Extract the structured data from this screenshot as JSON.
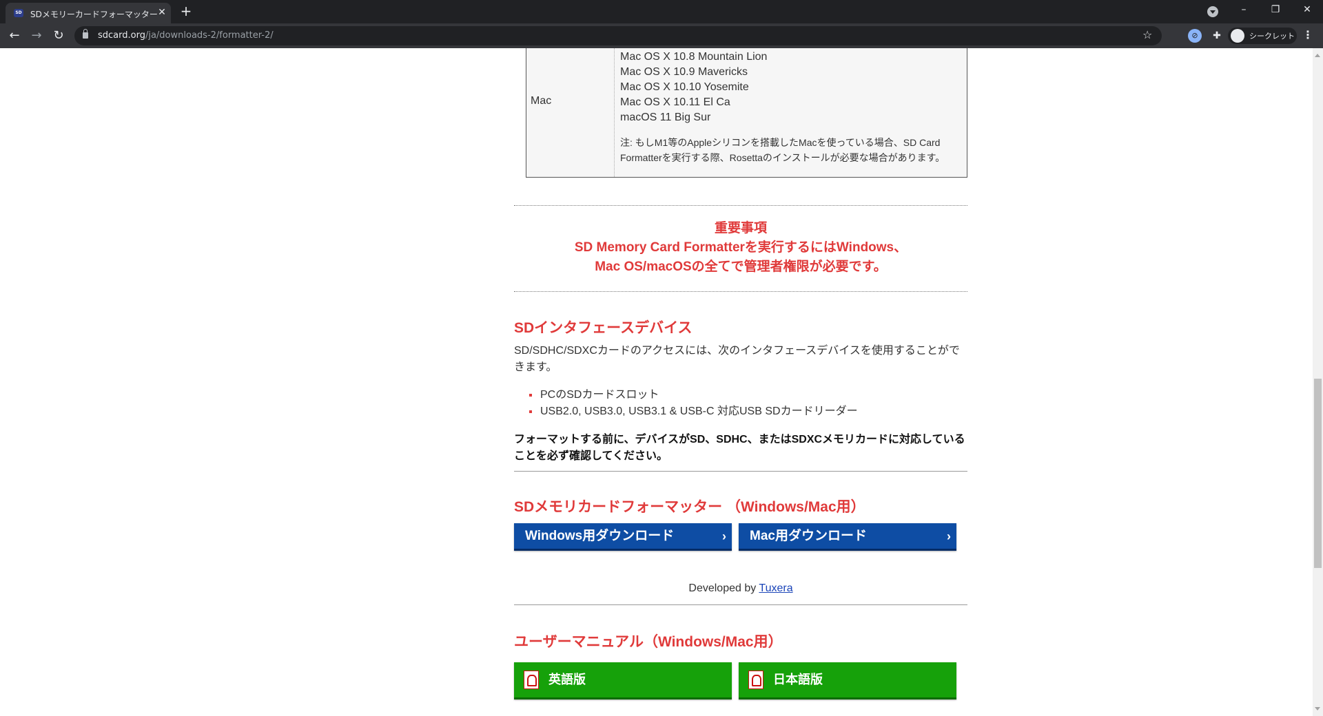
{
  "browser": {
    "tab_title": "SDメモリーカードフォーマッター | SD Association",
    "tab_favicon_text": "SD",
    "new_tab": "+",
    "url_host": "sdcard.org",
    "url_path": "/ja/downloads-2/formatter-2/",
    "incognito_label": "シークレット",
    "window_buttons": {
      "minimize": "–",
      "restore": "❐",
      "close": "✕"
    }
  },
  "requirements": {
    "os_label": "Mac",
    "versions": [
      "Mac OS X 10.8 Mountain Lion",
      "Mac OS X 10.9 Mavericks",
      "Mac OS X 10.10 Yosemite",
      "Mac OS X 10.11 El Ca",
      "macOS 11 Big Sur"
    ],
    "note": "注: もしM1等のAppleシリコンを搭載したMacを使っている場合、SD Card Formatterを実行する際、Rosettaのインストールが必要な場合があります。"
  },
  "notice": {
    "title": "重要事項",
    "line1": "SD Memory Card Formatterを実行するにはWindows、",
    "line2": "Mac OS/macOSの全てで管理者権限が必要です。"
  },
  "interface": {
    "heading": "SDインタフェースデバイス",
    "intro": "SD/SDHC/SDXCカードのアクセスには、次のインタフェースデバイスを使用することができます。",
    "items": [
      "PCのSDカードスロット",
      "USB2.0, USB3.0, USB3.1 & USB-C 対応USB SDカードリーダー"
    ],
    "warning": "フォーマットする前に、デバイスがSD、SDHC、またはSDXCメモリカードに対応していることを必ず確認してください。"
  },
  "formatter": {
    "heading": "SDメモリカードフォーマッター （Windows/Mac用）",
    "windows_button": "Windows用ダウンロード",
    "mac_button": "Mac用ダウンロード",
    "developed_by": "Developed by",
    "developer_link": "Tuxera"
  },
  "manual": {
    "heading": "ユーザーマニュアル（Windows/Mac用）",
    "english_button": "英語版",
    "japanese_button": "日本語版"
  },
  "colors": {
    "accent_red": "#e03a3a",
    "button_blue": "#0e4da4",
    "button_green": "#16a10a"
  },
  "icons": {
    "back": "arrow-left-icon",
    "forward": "arrow-right-icon",
    "reload": "reload-icon",
    "lock": "lock-icon",
    "bookmark": "star-icon",
    "pdf": "pdf-icon"
  }
}
